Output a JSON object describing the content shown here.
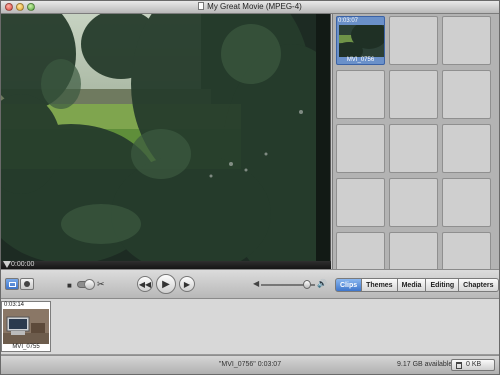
{
  "window": {
    "title": "My Great Movie (MPEG-4)"
  },
  "viewer": {
    "timecode": "0:00:00",
    "progress_fraction": 0.0
  },
  "clip_grid": {
    "clips": [
      {
        "time": "0:03:07",
        "name": "MVI_0756",
        "selected": true
      }
    ],
    "empty_cells": 14
  },
  "toolbar": {
    "icons": {
      "timeline_view": "film-strip-icon",
      "clip_view": "clock-icon",
      "camera": "camera-icon",
      "scissors": "scissors-icon",
      "rewind": "rewind-icon",
      "play": "play-icon",
      "fullscreen_play": "fullscreen-play-icon",
      "volume_low": "speaker-low-icon",
      "volume_high": "speaker-high-icon"
    },
    "volume_level": 0.92,
    "tabs": [
      {
        "label": "Clips",
        "active": true
      },
      {
        "label": "Themes",
        "active": false
      },
      {
        "label": "Media",
        "active": false
      },
      {
        "label": "Editing",
        "active": false
      },
      {
        "label": "Chapters",
        "active": false
      }
    ]
  },
  "timeline": {
    "clips": [
      {
        "time": "0:03:14",
        "name": "MVI_0755"
      }
    ]
  },
  "status": {
    "clip_info": "\"MVI_0756\"   0:03:07",
    "free_space": "9.17 GB available",
    "trash_label": "0 KB"
  },
  "colors": {
    "accent_blue": "#3e76cc",
    "selection_blue": "#6a90c9"
  }
}
